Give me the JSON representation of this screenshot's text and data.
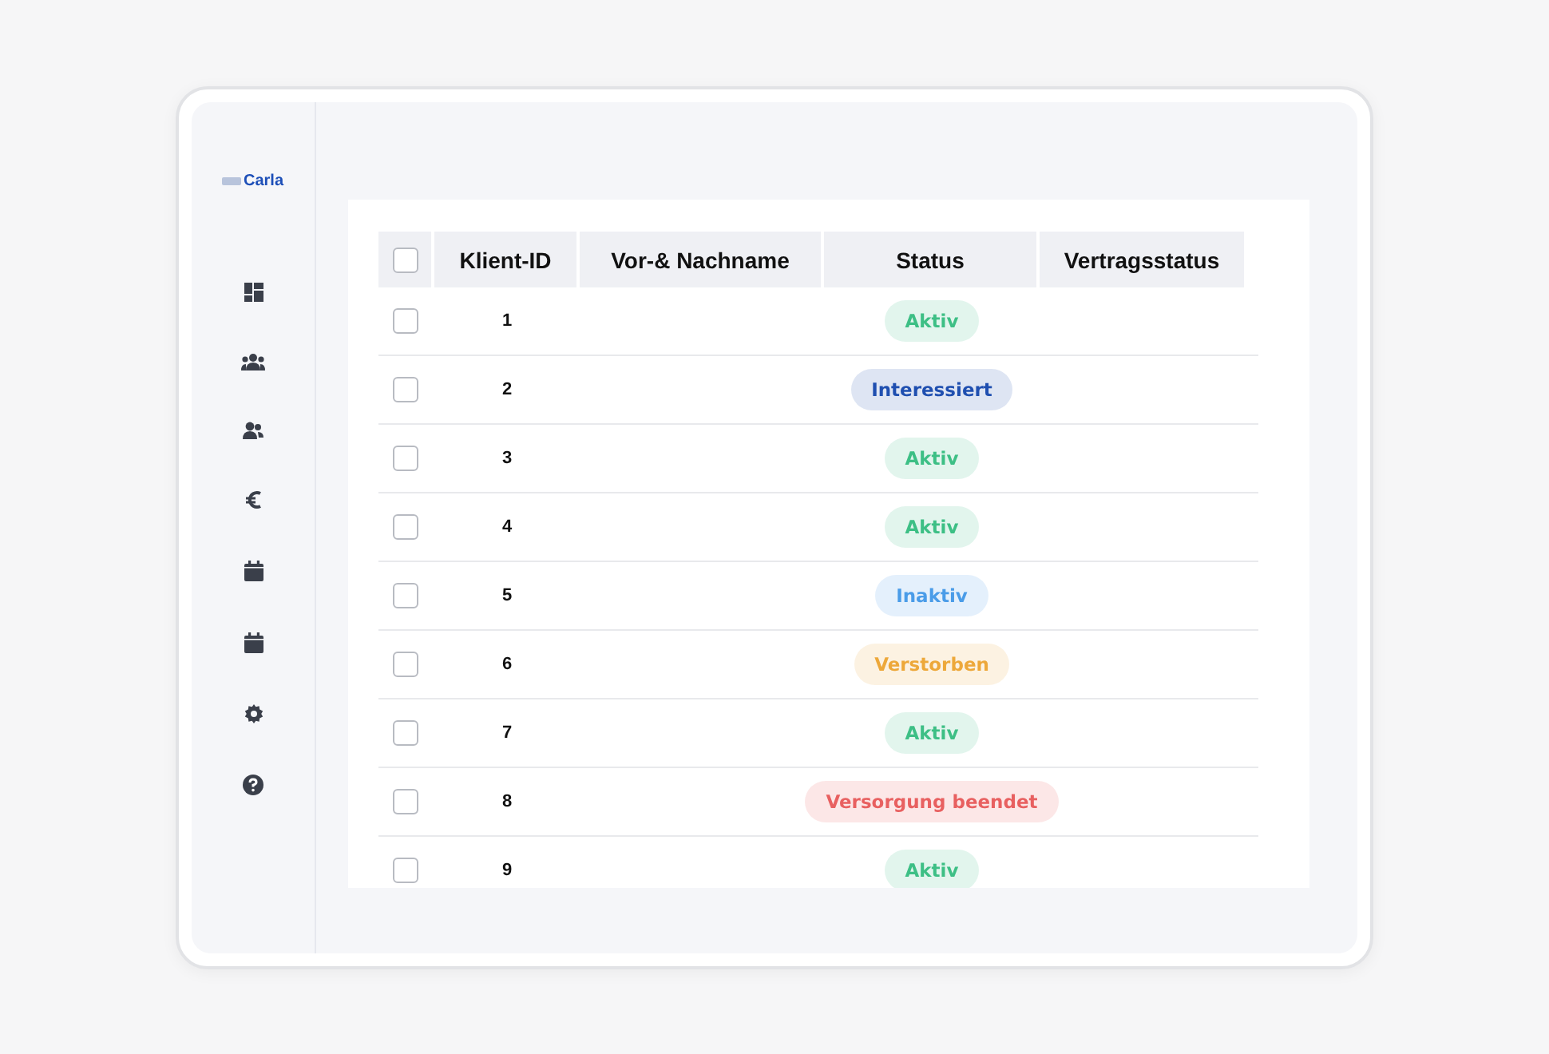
{
  "sidebar": {
    "logo": "Carla",
    "items": [
      {
        "kind": "dashboard"
      },
      {
        "kind": "group"
      },
      {
        "kind": "users"
      },
      {
        "kind": "euro"
      },
      {
        "kind": "calendar"
      },
      {
        "kind": "calendar"
      },
      {
        "kind": "settings"
      },
      {
        "kind": "help"
      }
    ]
  },
  "table": {
    "select_all": {
      "checked": false
    },
    "columns": [
      "Klient-ID",
      "Vor-& Nachname",
      "Status",
      "Vertragsstatus"
    ],
    "rows": [
      {
        "checked": false,
        "id": "1",
        "status": "Aktiv",
        "color": "#3dbf85"
      },
      {
        "checked": false,
        "id": "2",
        "status": "Interessiert",
        "color": "#1f4fb0"
      },
      {
        "checked": false,
        "id": "3",
        "status": "Aktiv",
        "color": "#3dbf85"
      },
      {
        "checked": false,
        "id": "4",
        "status": "Aktiv",
        "color": "#3dbf85"
      },
      {
        "checked": false,
        "id": "5",
        "status": "Inaktiv",
        "color": "#4a9ce8"
      },
      {
        "checked": false,
        "id": "6",
        "status": "Verstorben",
        "color": "#eda83a"
      },
      {
        "checked": false,
        "id": "7",
        "status": "Aktiv",
        "color": "#3dbf85"
      },
      {
        "checked": false,
        "id": "8",
        "status": "Versorgung beendet",
        "color": "#e86060"
      },
      {
        "checked": false,
        "id": "9",
        "status": "Aktiv",
        "color": "#3dbf85"
      }
    ]
  }
}
